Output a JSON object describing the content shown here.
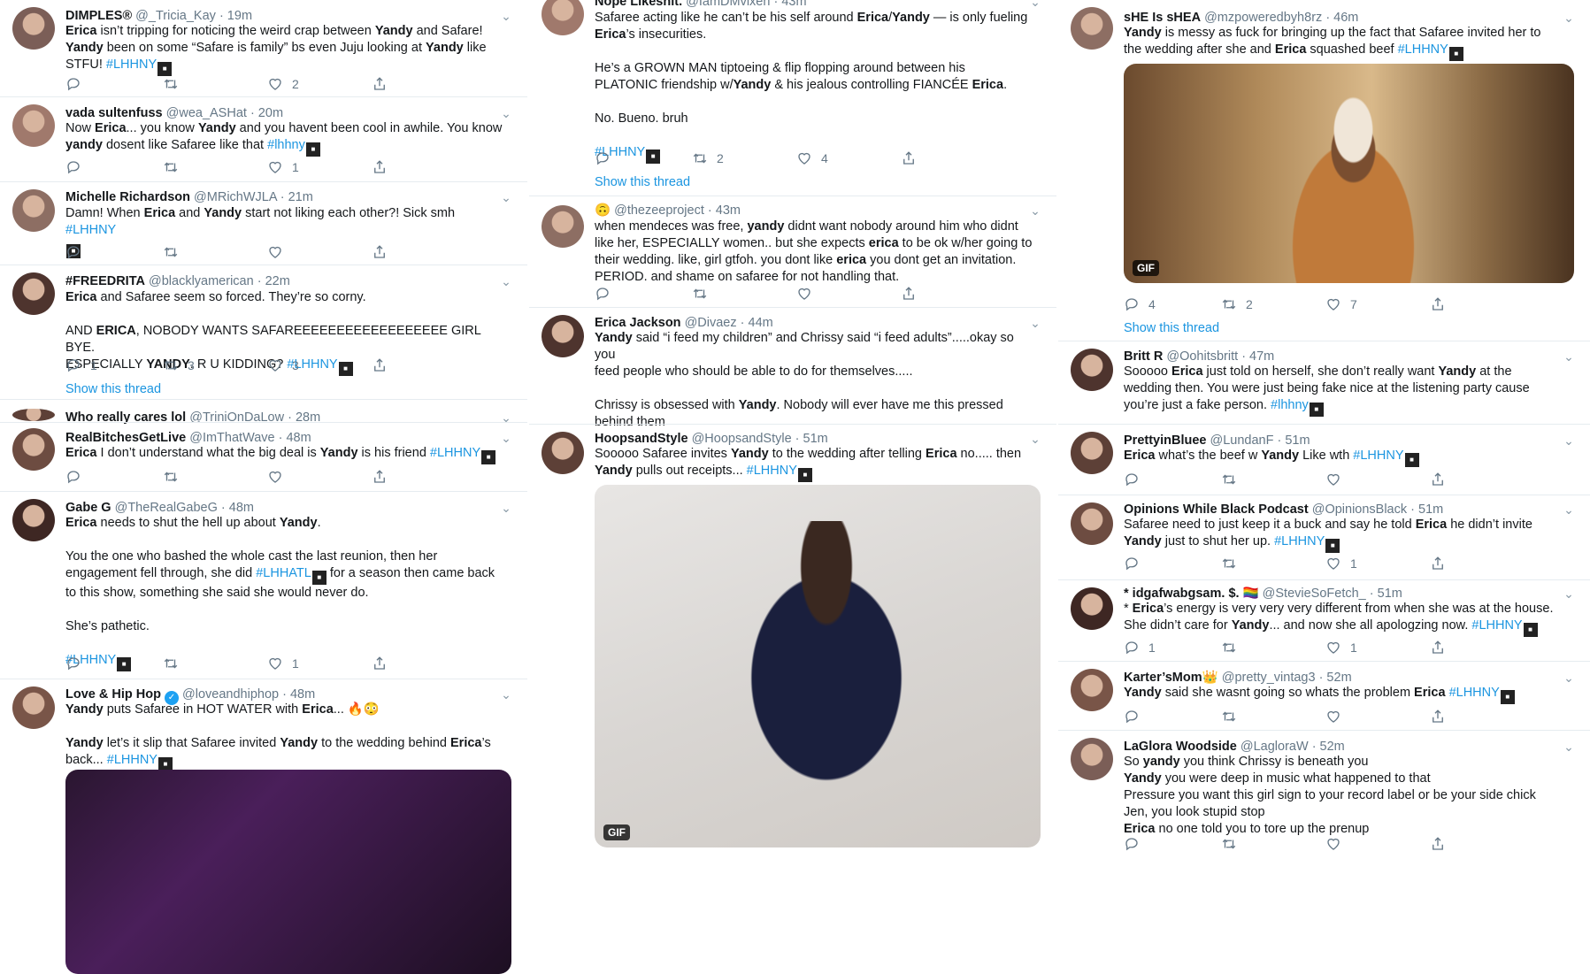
{
  "column1": [
    {
      "name": "DIMPLES®",
      "handle": "@_Tricia_Kay",
      "time": "· 19m",
      "body": [
        [
          "<b>Erica</b> isn’t tripping for noticing the weird crap between <b>Yandy</b> and Safare!"
        ],
        [
          "<b>Yandy</b> been on some “Safare is family”  bs even Juju looking at <b>Yandy</b> like"
        ],
        [
          "STFU! <t>#LHHNY</t><f>"
        ]
      ],
      "reply": "",
      "retweet": "",
      "like": "2"
    },
    {
      "name": "vada sultenfuss",
      "handle": "@wea_ASHat",
      "time": "· 20m",
      "body": [
        [
          "Now <b>Erica</b>...  you know <b>Yandy</b> and you havent been cool in awhile. You know"
        ],
        [
          "<b>yandy</b> dosent like Safaree like that <t>#lhhny</t><f>"
        ]
      ],
      "reply": "",
      "retweet": "",
      "like": "1"
    },
    {
      "name": "Michelle Richardson",
      "handle": "@MRichWJLA",
      "time": "· 21m",
      "body": [
        [
          "Damn! When <b>Erica</b> and <b>Yandy</b> start not liking each other?! Sick smh <t>#LHHNY</t>"
        ],
        [
          "<f>"
        ]
      ],
      "reply": "",
      "retweet": "",
      "like": ""
    },
    {
      "name": "#FREEDRITA",
      "handle": "@blacklyamerican",
      "time": "· 22m",
      "body": [
        [
          "<b>Erica</b> and Safaree seem so forced. They’re so corny."
        ],
        [
          "gap"
        ],
        [
          "AND <b>ERICA</b>, NOBODY WANTS SAFAREEEEEEEEEEEEEEEEEE GIRL BYE."
        ],
        [
          "ESPECIALLY <b>YANDY</b>. R U KIDDING? <t>#LHHNY</t><f>"
        ]
      ],
      "reply": "1",
      "retweet": "3",
      "like": "3",
      "thread": "Show this thread"
    },
    {
      "name": "Who really cares lol",
      "handle": "@TriniOnDaLow",
      "time": "· 28m"
    },
    {
      "name": "RealBitchesGetLive",
      "handle": "@ImThatWave",
      "time": "· 48m",
      "body": [
        [
          "<b>Erica</b> I don’t understand what the big deal is <b>Yandy</b> is his friend <t>#LHHNY</t><f>"
        ]
      ],
      "reply": "",
      "retweet": "",
      "like": ""
    },
    {
      "name": "Gabe G",
      "handle": "@TheRealGabeG",
      "time": "· 48m",
      "body": [
        [
          "<b>Erica</b> needs to shut the hell up about <b>Yandy</b>."
        ],
        [
          "gap"
        ],
        [
          "You the one who bashed the whole cast the last reunion, then her"
        ],
        [
          "engagement fell through, she did <t>#LHHATL</t><f> for a season then came back"
        ],
        [
          "to this show, something she said she would never do."
        ],
        [
          "gap"
        ],
        [
          "She’s pathetic."
        ],
        [
          "gap"
        ],
        [
          "<t>#LHHNY</t><f>"
        ]
      ],
      "reply": "",
      "retweet": "",
      "like": "1"
    },
    {
      "name": "Love & Hip Hop",
      "handle": "@loveandhiphop",
      "time": "· 48m",
      "body": [
        [
          "<b>Yandy</b> puts Safaree in HOT WATER with <b>Erica</b>... 🔥😳"
        ],
        [
          "gap"
        ],
        [
          "<b>Yandy</b> let’s it slip that Safaree invited <b>Yandy</b> to the wedding behind <b>Erica</b>’s"
        ],
        [
          "back... <t>#LHHNY</t><f>"
        ]
      ]
    }
  ],
  "column2": [
    {
      "name": "Nope Likeshit.",
      "handle": "@IamDMvixen",
      "time": "· 43m",
      "body": [
        [
          "Safaree acting like he can’t be his self around <b>Erica</b>/<b>Yandy</b> — is only fueling"
        ],
        [
          "<b>Erica</b>’s insecurities."
        ],
        [
          "gap"
        ],
        [
          "He’s a GROWN MAN tiptoeing & flip flopping around between his"
        ],
        [
          "PLATONIC friendship w/<b>Yandy</b> & his jealous controlling FIANCÉE <b>Erica</b>."
        ],
        [
          "gap"
        ],
        [
          "No. Bueno. bruh"
        ],
        [
          "gap"
        ],
        [
          "<t>#LHHNY</t><f>"
        ]
      ],
      "reply": "",
      "retweet": "2",
      "like": "4",
      "thread": "Show this thread"
    },
    {
      "name": "🙃",
      "handle": "@thezeeproject",
      "time": "· 43m",
      "body": [
        [
          "when mendeces was free, <b>yandy</b> didnt want nobody around him who didnt"
        ],
        [
          "like her, ESPECIALLY women.. but she expects <b>erica</b> to be ok w/her going to"
        ],
        [
          "their wedding. like, girl gtfoh. you dont like <b>erica</b> you dont get an invitation."
        ],
        [
          "PERIOD. and shame on safaree for not handling that."
        ]
      ],
      "reply": "",
      "retweet": "",
      "like": ""
    },
    {
      "name": "Erica Jackson",
      "handle": "@Divaez",
      "time": "· 44m",
      "body": [
        [
          "<b>Yandy</b> said “i feed my children” and Chrissy said “i feed adults”.....okay so you"
        ],
        [
          "feed people who should be able to  do for themselves....."
        ],
        [
          "gap"
        ],
        [
          "Chrissy is obsessed with <b>Yandy</b>. Nobody will ever have me this pressed"
        ],
        [
          "behind them"
        ]
      ]
    },
    {
      "name": "HoopsandStyle",
      "handle": "@HoopsandStyle",
      "time": "· 51m",
      "body": [
        [
          "Sooooo Safaree invites <b>Yandy</b> to the wedding after telling <b>Erica</b> no..... then"
        ],
        [
          "<b>Yandy</b> pulls out receipts... <t>#LHHNY</t><f>"
        ]
      ],
      "media_badge": "GIF"
    }
  ],
  "column3": [
    {
      "name": "sHE Is sHEA",
      "handle": "@mzpoweredbyh8rz",
      "time": "· 46m",
      "body": [
        [
          "<b>Yandy</b> is messy as fuck for bringing up the fact that Safaree invited her to"
        ],
        [
          "the wedding after she and <b>Erica</b> squashed beef  <t>#LHHNY</t><f>"
        ]
      ],
      "media_badge": "GIF",
      "reply": "4",
      "retweet": "2",
      "like": "7",
      "thread": "Show this thread"
    },
    {
      "name": "Britt R",
      "handle": "@Oohitsbritt",
      "time": "· 47m",
      "body": [
        [
          "Sooooo <b>Erica</b> just told on herself, she don’t really want <b>Yandy</b> at the"
        ],
        [
          "wedding then. You were just being fake nice at the listening party cause"
        ],
        [
          "you’re just a fake person. <t>#lhhny</t><f>"
        ]
      ]
    },
    {
      "name": "PrettyinBluee",
      "handle": "@LundanF",
      "time": "· 51m",
      "body": [
        [
          "<b>Erica</b> what’s the beef w <b>Yandy</b> Like wth <t>#LHHNY</t><f>"
        ]
      ],
      "reply": "",
      "retweet": "",
      "like": ""
    },
    {
      "name": "Opinions While Black Podcast",
      "handle": "@OpinionsBlack",
      "time": "· 51m",
      "body": [
        [
          "Safaree need to just keep it a buck and say he told <b>Erica</b> he didn’t invite"
        ],
        [
          "<b>Yandy</b> just to shut her up. <t>#LHHNY</t><f>"
        ]
      ],
      "reply": "",
      "retweet": "",
      "like": "1"
    },
    {
      "name": "* idgafwabgsam. $. 🏳️‍🌈",
      "handle": "@StevieSoFetch_",
      "time": "· 51m",
      "body": [
        [
          "* <b>Erica</b>’s energy is very very very different from when she was at the house."
        ],
        [
          "She didn’t care for <b>Yandy</b>... and now she all apologzing now. <t>#LHHNY</t><f>"
        ]
      ],
      "reply": "1",
      "retweet": "",
      "like": "1"
    },
    {
      "name": "Karter’sMom👑",
      "handle": "@pretty_vintag3",
      "time": "· 52m",
      "body": [
        [
          "<b>Yandy</b> said she wasnt going so whats the problem <b>Erica</b> <t>#LHHNY</t><f>"
        ]
      ],
      "reply": "",
      "retweet": "",
      "like": ""
    },
    {
      "name": "LaGlora Woodside",
      "handle": "@LagloraW",
      "time": "· 52m",
      "body": [
        [
          "So <b>yandy</b> you think Chrissy is beneath you"
        ],
        [
          "<b>Yandy</b> you were deep in music what happened to that"
        ],
        [
          "Pressure you want this girl sign to your record label or be your side chick"
        ],
        [
          "Jen, you look stupid stop"
        ],
        [
          "<b>Erica</b> no one told you to tore up the prenup"
        ]
      ],
      "reply": "",
      "retweet": "",
      "like": ""
    }
  ],
  "icons": {
    "reply": "reply-icon",
    "retweet": "retweet-icon",
    "like": "like-icon",
    "share": "share-icon",
    "menu": "chevron-down-icon"
  },
  "colors": {
    "link": "#1b95e0",
    "text": "#14171a",
    "muted": "#657786",
    "divider": "#e6ecf0"
  }
}
